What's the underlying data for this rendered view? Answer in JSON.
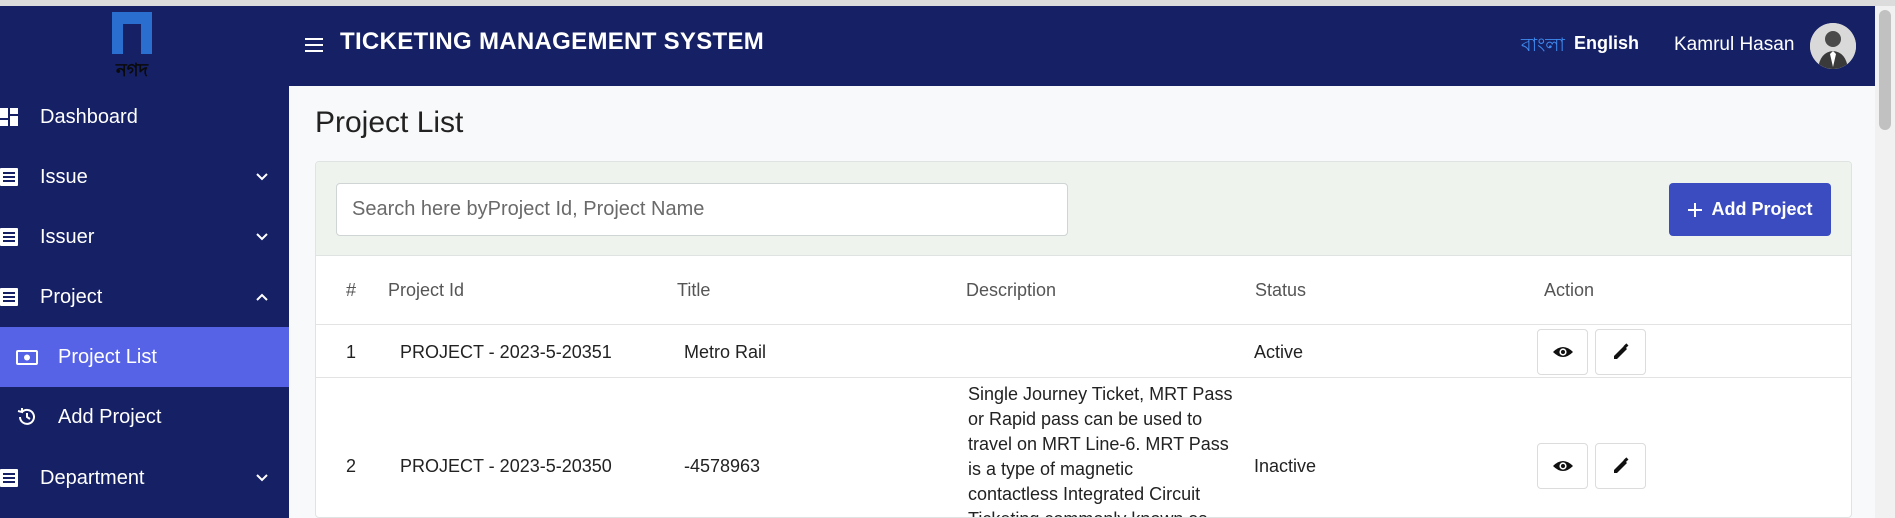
{
  "header": {
    "app_title": "TICKETING MANAGEMENT SYSTEM",
    "lang_bangla": "বাংলা",
    "lang_english": "English",
    "user_name": "Kamrul Hasan"
  },
  "sidebar": {
    "logo_text": "নগদ",
    "items": [
      {
        "label": "Dashboard",
        "icon": "dashboard-icon"
      },
      {
        "label": "Issue",
        "icon": "list-icon",
        "chevron": "down"
      },
      {
        "label": "Issuer",
        "icon": "list-icon",
        "chevron": "down"
      },
      {
        "label": "Project",
        "icon": "list-icon",
        "chevron": "up"
      },
      {
        "label": "Department",
        "icon": "list-icon",
        "chevron": "down"
      }
    ],
    "project_sub": [
      {
        "label": "Project List",
        "icon": "money-icon",
        "active": true
      },
      {
        "label": "Add Project",
        "icon": "history-icon",
        "active": false
      }
    ]
  },
  "main": {
    "page_title": "Project List",
    "search_placeholder": "Search here byProject Id, Project Name",
    "add_button_label": "Add Project",
    "columns": [
      "#",
      "Project Id",
      "Title",
      "Description",
      "Status",
      "Action"
    ],
    "rows": [
      {
        "num": "1",
        "project_id": "PROJECT - 2023-5-20351",
        "title": "Metro Rail",
        "description": "",
        "status": "Active"
      },
      {
        "num": "2",
        "project_id": "PROJECT - 2023-5-20350",
        "title": "-4578963",
        "description": [
          "Single Journey Ticket, MRT Pass",
          "or Rapid pass can be used to",
          "travel on MRT Line-6. MRT Pass",
          "is a type of magnetic",
          "contactless Integrated Circuit",
          "Ticketing commonly known as"
        ],
        "status": "Inactive"
      }
    ]
  },
  "colors": {
    "navy": "#152065",
    "active_item": "#5763e6",
    "primary_button": "#3b4cc0",
    "bangla_link": "#3f8bf0"
  }
}
